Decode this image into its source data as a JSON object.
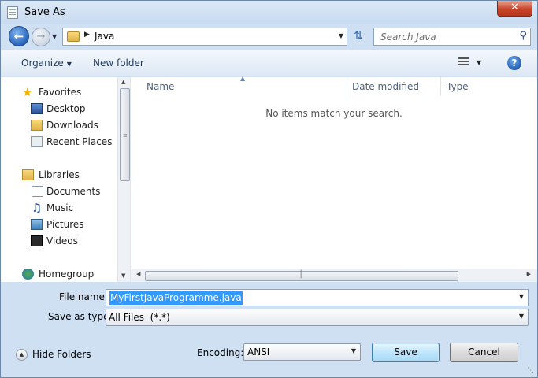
{
  "window": {
    "title": "Save As",
    "close_label": "✕"
  },
  "nav": {
    "current_folder": "Java",
    "search_placeholder": "Search Java"
  },
  "toolbar": {
    "organize_label": "Organize",
    "new_folder_label": "New folder",
    "help_label": "?"
  },
  "sidebar": {
    "favorites": "Favorites",
    "desktop": "Desktop",
    "downloads": "Downloads",
    "recent_places": "Recent Places",
    "libraries": "Libraries",
    "documents": "Documents",
    "music": "Music",
    "pictures": "Pictures",
    "videos": "Videos",
    "homegroup": "Homegroup"
  },
  "file_list": {
    "columns": [
      "Name",
      "Date modified",
      "Type"
    ],
    "empty_message": "No items match your search."
  },
  "form": {
    "file_name_label": "File name:",
    "file_name_value": "MyFirstJavaProgramme.java",
    "save_as_type_label": "Save as type:",
    "save_as_type_value": "All Files  (*.*)"
  },
  "footer": {
    "hide_folders_label": "Hide Folders",
    "encoding_label": "Encoding:",
    "encoding_value": "ANSI",
    "save_label": "Save",
    "cancel_label": "Cancel"
  },
  "icons": {
    "back": "back-arrow-icon",
    "forward": "forward-arrow-icon",
    "refresh": "refresh-icon",
    "search": "search-icon",
    "views": "views-icon",
    "help": "help-icon"
  },
  "colors": {
    "accent": "#3399ff",
    "window_frame": "#cfe0f2",
    "close_button": "#c8452a"
  }
}
